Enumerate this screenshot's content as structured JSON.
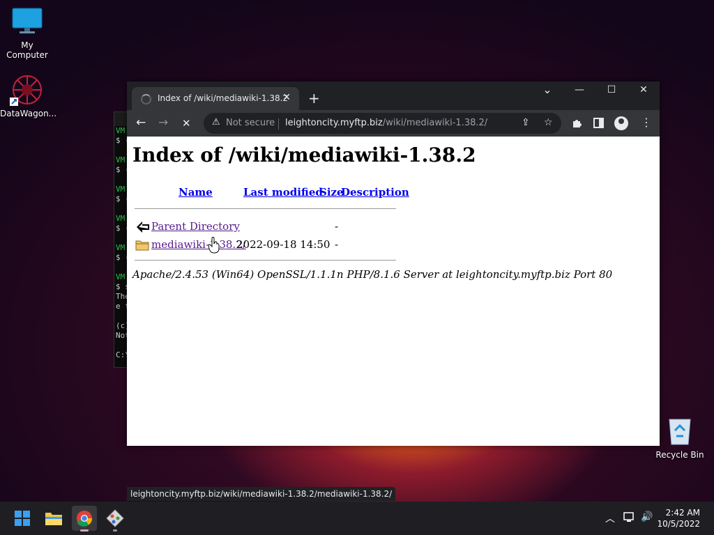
{
  "desktop": {
    "icons": [
      {
        "label": "My Computer",
        "icon": "monitor-icon"
      },
      {
        "label": "DataWagon...",
        "icon": "datawagon-icon"
      },
      {
        "label": "Recycle Bin",
        "icon": "recycle-bin-icon"
      }
    ]
  },
  "terminal": {
    "lines": [
      "VM",
      "$ (",
      "VM",
      "$ (",
      "VM",
      "$ (",
      "VM",
      "$ (",
      "VM",
      "$ (",
      "VM",
      "$ s",
      "The",
      "e t",
      "(c)",
      "Not",
      "C:\\"
    ]
  },
  "browser": {
    "tab_title": "Index of /wiki/mediawiki-1.38.2",
    "tab_close": "✕",
    "new_tab": "+",
    "window_controls": {
      "tabsearch": "⌄",
      "minimize": "—",
      "maximize": "☐",
      "close": "✕"
    },
    "nav": {
      "back": "←",
      "forward": "→",
      "stop": "✕"
    },
    "security_label": "Not secure",
    "url_host": "leightoncity.myftp.biz",
    "url_path": "/wiki/mediawiki-1.38.2/",
    "status_url": "leightoncity.myftp.biz/wiki/mediawiki-1.38.2/mediawiki-1.38.2/"
  },
  "page": {
    "heading": "Index of /wiki/mediawiki-1.38.2",
    "columns": {
      "name": "Name",
      "last_modified": "Last modified",
      "size": "Size",
      "description": "Description"
    },
    "rows": [
      {
        "name": "Parent Directory",
        "modified": "",
        "size": "-",
        "icon": "back-arrow-icon"
      },
      {
        "name": "mediawiki-1.38.2/",
        "modified": "2022-09-18 14:50",
        "size": "-",
        "icon": "folder-icon"
      }
    ],
    "server_signature": "Apache/2.4.53 (Win64) OpenSSL/1.1.1n PHP/8.1.6 Server at leightoncity.myftp.biz Port 80"
  },
  "taskbar": {
    "apps": [
      "start-icon",
      "file-explorer-icon",
      "chrome-icon",
      "git-icon"
    ],
    "clock_time": "2:42 AM",
    "clock_date": "10/5/2022"
  }
}
